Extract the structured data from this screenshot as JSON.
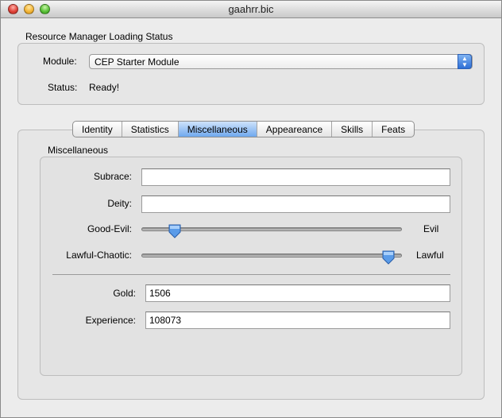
{
  "window": {
    "title": "gaahrr.bic"
  },
  "status_box": {
    "heading": "Resource Manager Loading Status",
    "module_label": "Module:",
    "module_value": "CEP Starter Module",
    "status_label": "Status:",
    "status_value": "Ready!"
  },
  "tabs": [
    {
      "label": "Identity"
    },
    {
      "label": "Statistics"
    },
    {
      "label": "Miscellaneous"
    },
    {
      "label": "Appeareance"
    },
    {
      "label": "Skills"
    },
    {
      "label": "Feats"
    }
  ],
  "active_tab": "Miscellaneous",
  "misc": {
    "group_title": "Miscellaneous",
    "subrace_label": "Subrace:",
    "subrace_value": "",
    "deity_label": "Deity:",
    "deity_value": "",
    "good_evil_label": "Good-Evil:",
    "good_evil_end": "Evil",
    "good_evil_level": 0.11,
    "lawful_chaotic_label": "Lawful-Chaotic:",
    "lawful_chaotic_end": "Lawful",
    "lawful_chaotic_level": 0.97,
    "gold_label": "Gold:",
    "gold_value": "1506",
    "experience_label": "Experience:",
    "experience_value": "108073"
  },
  "colors": {
    "accent": "#6fa8ee",
    "thumb": "#4a90e2"
  }
}
